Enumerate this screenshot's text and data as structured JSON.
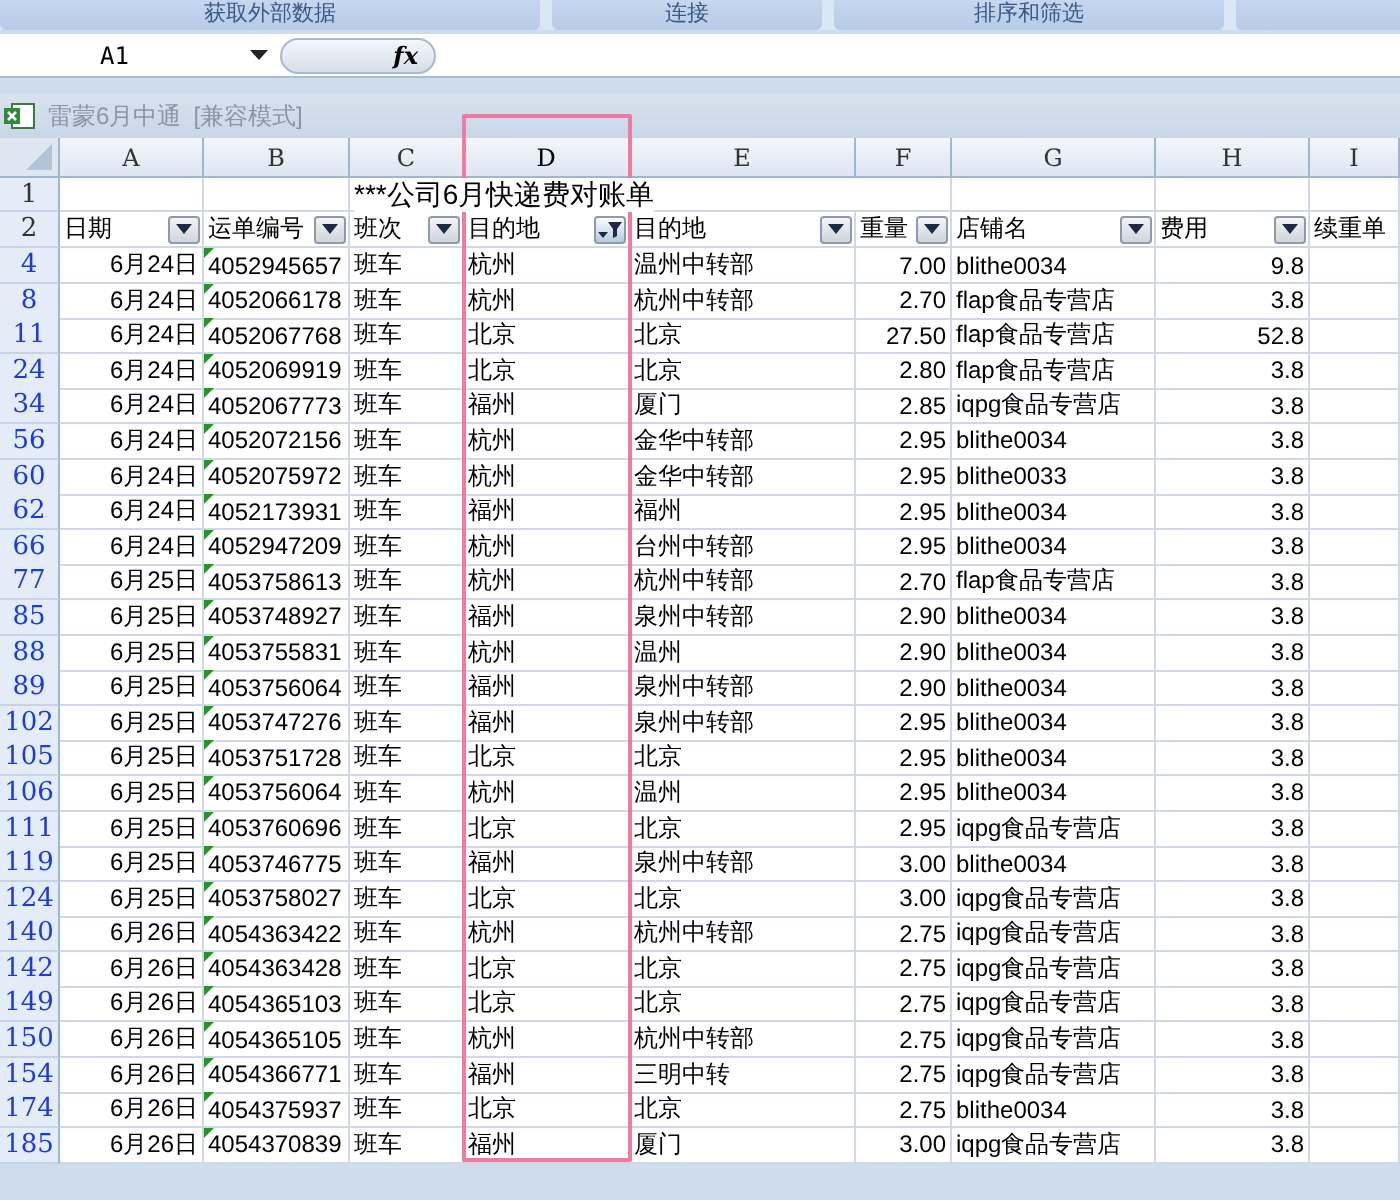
{
  "ribbon_groups": [
    "获取外部数据",
    "连接",
    "排序和筛选"
  ],
  "formula_bar": {
    "name_box": "A1",
    "fx": "fx"
  },
  "workbook": {
    "title": "雷蒙6月中通",
    "mode": "[兼容模式]"
  },
  "columns": [
    {
      "letter": "A",
      "header": "日期",
      "kind": "date",
      "filtered": false,
      "highlighted": false
    },
    {
      "letter": "B",
      "header": "运单编号",
      "kind": "numtext",
      "filtered": false,
      "highlighted": false
    },
    {
      "letter": "C",
      "header": "班次",
      "kind": "text",
      "filtered": false,
      "highlighted": false
    },
    {
      "letter": "D",
      "header": "目的地",
      "kind": "text",
      "filtered": true,
      "highlighted": true
    },
    {
      "letter": "E",
      "header": "目的地",
      "kind": "text",
      "filtered": false,
      "highlighted": false
    },
    {
      "letter": "F",
      "header": "重量",
      "kind": "number",
      "filtered": false,
      "highlighted": false
    },
    {
      "letter": "G",
      "header": "店铺名",
      "kind": "text",
      "filtered": false,
      "highlighted": false
    },
    {
      "letter": "H",
      "header": "费用",
      "kind": "number",
      "filtered": false,
      "highlighted": false
    },
    {
      "letter": "I",
      "header": "续重单",
      "kind": "text",
      "highlighted": false
    }
  ],
  "title_row": {
    "number": "1",
    "text": "***公司6月快递费对账单"
  },
  "header_row": {
    "number": "2"
  },
  "rows": [
    {
      "number": "4",
      "cells": [
        "6月24日",
        "4052945657",
        "班车",
        "杭州",
        "温州中转部",
        "7.00",
        "blithe0034",
        "9.8"
      ]
    },
    {
      "number": "8",
      "cells": [
        "6月24日",
        "4052066178",
        "班车",
        "杭州",
        "杭州中转部",
        "2.70",
        "flap食品专营店",
        "3.8"
      ]
    },
    {
      "number": "11",
      "cells": [
        "6月24日",
        "4052067768",
        "班车",
        "北京",
        "北京",
        "27.50",
        "flap食品专营店",
        "52.8"
      ]
    },
    {
      "number": "24",
      "cells": [
        "6月24日",
        "4052069919",
        "班车",
        "北京",
        "北京",
        "2.80",
        "flap食品专营店",
        "3.8"
      ]
    },
    {
      "number": "34",
      "cells": [
        "6月24日",
        "4052067773",
        "班车",
        "福州",
        "厦门",
        "2.85",
        "iqpg食品专营店",
        "3.8"
      ]
    },
    {
      "number": "56",
      "cells": [
        "6月24日",
        "4052072156",
        "班车",
        "杭州",
        "金华中转部",
        "2.95",
        "blithe0034",
        "3.8"
      ]
    },
    {
      "number": "60",
      "cells": [
        "6月24日",
        "4052075972",
        "班车",
        "杭州",
        "金华中转部",
        "2.95",
        "blithe0033",
        "3.8"
      ]
    },
    {
      "number": "62",
      "cells": [
        "6月24日",
        "4052173931",
        "班车",
        "福州",
        "福州",
        "2.95",
        "blithe0034",
        "3.8"
      ]
    },
    {
      "number": "66",
      "cells": [
        "6月24日",
        "4052947209",
        "班车",
        "杭州",
        "台州中转部",
        "2.95",
        "blithe0034",
        "3.8"
      ]
    },
    {
      "number": "77",
      "cells": [
        "6月25日",
        "4053758613",
        "班车",
        "杭州",
        "杭州中转部",
        "2.70",
        "flap食品专营店",
        "3.8"
      ]
    },
    {
      "number": "85",
      "cells": [
        "6月25日",
        "4053748927",
        "班车",
        "福州",
        "泉州中转部",
        "2.90",
        "blithe0034",
        "3.8"
      ]
    },
    {
      "number": "88",
      "cells": [
        "6月25日",
        "4053755831",
        "班车",
        "杭州",
        "温州",
        "2.90",
        "blithe0034",
        "3.8"
      ]
    },
    {
      "number": "89",
      "cells": [
        "6月25日",
        "4053756064",
        "班车",
        "福州",
        "泉州中转部",
        "2.90",
        "blithe0034",
        "3.8"
      ]
    },
    {
      "number": "102",
      "cells": [
        "6月25日",
        "4053747276",
        "班车",
        "福州",
        "泉州中转部",
        "2.95",
        "blithe0034",
        "3.8"
      ]
    },
    {
      "number": "105",
      "cells": [
        "6月25日",
        "4053751728",
        "班车",
        "北京",
        "北京",
        "2.95",
        "blithe0034",
        "3.8"
      ]
    },
    {
      "number": "106",
      "cells": [
        "6月25日",
        "4053756064",
        "班车",
        "杭州",
        "温州",
        "2.95",
        "blithe0034",
        "3.8"
      ]
    },
    {
      "number": "111",
      "cells": [
        "6月25日",
        "4053760696",
        "班车",
        "北京",
        "北京",
        "2.95",
        "iqpg食品专营店",
        "3.8"
      ]
    },
    {
      "number": "119",
      "cells": [
        "6月25日",
        "4053746775",
        "班车",
        "福州",
        "泉州中转部",
        "3.00",
        "blithe0034",
        "3.8"
      ]
    },
    {
      "number": "124",
      "cells": [
        "6月25日",
        "4053758027",
        "班车",
        "北京",
        "北京",
        "3.00",
        "iqpg食品专营店",
        "3.8"
      ]
    },
    {
      "number": "140",
      "cells": [
        "6月26日",
        "4054363422",
        "班车",
        "杭州",
        "杭州中转部",
        "2.75",
        "iqpg食品专营店",
        "3.8"
      ]
    },
    {
      "number": "142",
      "cells": [
        "6月26日",
        "4054363428",
        "班车",
        "北京",
        "北京",
        "2.75",
        "iqpg食品专营店",
        "3.8"
      ]
    },
    {
      "number": "149",
      "cells": [
        "6月26日",
        "4054365103",
        "班车",
        "北京",
        "北京",
        "2.75",
        "iqpg食品专营店",
        "3.8"
      ]
    },
    {
      "number": "150",
      "cells": [
        "6月26日",
        "4054365105",
        "班车",
        "杭州",
        "杭州中转部",
        "2.75",
        "iqpg食品专营店",
        "3.8"
      ]
    },
    {
      "number": "154",
      "cells": [
        "6月26日",
        "4054366771",
        "班车",
        "福州",
        "三明中转",
        "2.75",
        "iqpg食品专营店",
        "3.8"
      ]
    },
    {
      "number": "174",
      "cells": [
        "6月26日",
        "4054375937",
        "班车",
        "北京",
        "北京",
        "2.75",
        "blithe0034",
        "3.8"
      ]
    },
    {
      "number": "185",
      "cells": [
        "6月26日",
        "4054370839",
        "班车",
        "福州",
        "厦门",
        "3.00",
        "iqpg食品专营店",
        "3.8"
      ]
    }
  ]
}
